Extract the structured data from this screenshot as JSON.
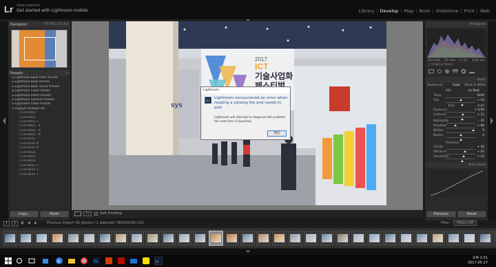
{
  "app": {
    "logo": "Lr",
    "brand": "Adobe Lightroom",
    "tagline": "Get started with Lightroom mobile"
  },
  "modules": [
    "Library",
    "Develop",
    "Map",
    "Book",
    "Slideshow",
    "Print",
    "Web"
  ],
  "active_module": "Develop",
  "left_panel": {
    "navigator_title": "Navigator",
    "zoom_options": "FIT  FILL  1:1  3:1",
    "presets_title": "Presets",
    "presets": [
      {
        "label": "Lightroom B&W Filter Presets",
        "level": 0
      },
      {
        "label": "Lightroom B&W Presets",
        "level": 0
      },
      {
        "label": "Lightroom B&W Toned Presets",
        "level": 0
      },
      {
        "label": "Lightroom Color Presets",
        "level": 0
      },
      {
        "label": "Lightroom Effect Presets",
        "level": 0
      },
      {
        "label": "Lightroom General Presets",
        "level": 0
      },
      {
        "label": "Lightroom Video Presets",
        "level": 0
      },
      {
        "label": "mygiyle Analog-Chic",
        "level": 0
      },
      {
        "label": "CH-AA01",
        "level": 1
      },
      {
        "label": "CH-AA02",
        "level": 1
      },
      {
        "label": "CH-AA03 +",
        "level": 1
      },
      {
        "label": "CH-AB01 - #",
        "level": 1
      },
      {
        "label": "CH-AB02 - #",
        "level": 1
      },
      {
        "label": "CH-AB03 - #",
        "level": 1
      },
      {
        "label": "CH-AC01",
        "level": 1
      },
      {
        "label": "CH-AC02 #",
        "level": 1
      },
      {
        "label": "CH-AC03 #",
        "level": 1
      },
      {
        "label": "CH-AD01",
        "level": 1
      },
      {
        "label": "CH-AD02",
        "level": 1
      },
      {
        "label": "CH-AD03",
        "level": 1
      },
      {
        "label": "CH-AE01 +",
        "level": 1
      },
      {
        "label": "CH-AE02 +",
        "level": 1
      },
      {
        "label": "CH-AE03 +",
        "level": 1
      }
    ],
    "copy_label": "Copy...",
    "paste_label": "Paste"
  },
  "photo_sign": {
    "year": "2017",
    "brand": "ICT",
    "line1": "기술사업화",
    "line2": "페스티벌",
    "side": "sys"
  },
  "dialog": {
    "title": "Lightroom",
    "icon_label": "Lr",
    "message": "Lightroom encountered an error when reading a catalog file and needs to quit.",
    "detail": "Lightroom will attempt to diagnose the problem the next time it launches.",
    "ok_label": "확인"
  },
  "toolbar": {
    "soft_proofing": "Soft Proofing"
  },
  "right_panel": {
    "histogram_title": "Histogram",
    "readout": [
      "ISO 500",
      "55 mm",
      "f / 22",
      "1/30 sec"
    ],
    "original_photo": "Original Photo",
    "basic_title": "Basic",
    "treatment_label": "Treatment :",
    "treatment_options": [
      "Color",
      "Black & White"
    ],
    "wb_label": "WB :",
    "wb_value": "As Shot",
    "tone_label": "Tone",
    "tone_auto": "Auto",
    "presence_label": "Presence",
    "tone_curve_title": "Tone Curve",
    "sliders": [
      {
        "name": "Temp",
        "value": "5200",
        "pos": 0.52,
        "group": "wb"
      },
      {
        "name": "Tint",
        "value": "+ 16",
        "pos": 0.56,
        "group": "wb"
      },
      {
        "name": "Exposure",
        "value": "+ 0.90",
        "pos": 0.59,
        "group": "tone"
      },
      {
        "name": "Contrast",
        "value": "+ 11",
        "pos": 0.55,
        "group": "tone"
      },
      {
        "name": "Highlights",
        "value": "- 35",
        "pos": 0.33,
        "group": "tone2"
      },
      {
        "name": "Shadows",
        "value": "+ 86",
        "pos": 0.92,
        "group": "tone2"
      },
      {
        "name": "Whites",
        "value": "0",
        "pos": 0.5,
        "group": "tone2"
      },
      {
        "name": "Blacks",
        "value": "0",
        "pos": 0.5,
        "group": "tone2"
      },
      {
        "name": "Clarity",
        "value": "+ 30",
        "pos": 0.65,
        "group": "presence"
      },
      {
        "name": "Vibrance",
        "value": "+ 20",
        "pos": 0.6,
        "group": "presence"
      },
      {
        "name": "Saturation",
        "value": "+ 10",
        "pos": 0.55,
        "group": "presence"
      }
    ],
    "previous_label": "Previous",
    "reset_label": "Reset"
  },
  "filmstrip": {
    "page1": "1",
    "page2": "2",
    "source": "Previous Import",
    "count_text": "91 photos / 1 selected / BD1A0291.CR2",
    "filter_label": "Filter :",
    "filter_value": "Filters Off",
    "thumb_colors": [
      "#4a6c9a",
      "#6f8fb3",
      "#8aa6c2",
      "#c98a52",
      "#7c8fa3",
      "#9fb0bf",
      "#5d7796",
      "#b79c76",
      "#8aa0b6",
      "#a5906b",
      "#637e99",
      "#98abc0",
      "#7a8ea6",
      "#d08a3e",
      "#c47a3a",
      "#6d87a4",
      "#b98c5e",
      "#d39450",
      "#8d9db2",
      "#a7b5c4",
      "#708aa7",
      "#8d7a67",
      "#a0b3c6",
      "#8ba5c4",
      "#5f7a98",
      "#9fb4cc",
      "#6e89a9",
      "#c2a07a",
      "#7d94ae",
      "#aabbd0",
      "#5a7392",
      "#93a8c0",
      "#b7c2cf",
      "#6b84a0",
      "#9aaec4",
      "#8098b3",
      "#c4cfdb",
      "#a0805f",
      "#b4c2d3",
      "#d0d6dd",
      "#7a90aa",
      "#bfc9d5",
      "#8aa1ba"
    ],
    "selected_index": 13
  },
  "taskbar": {
    "time": "오후 2:31",
    "date": "2017-05-27",
    "apps": [
      "start",
      "search",
      "taskview",
      "edge",
      "explorer",
      "chrome",
      "photoshop",
      "office",
      "acrobat",
      "mail",
      "kakao",
      "lightroom"
    ]
  }
}
